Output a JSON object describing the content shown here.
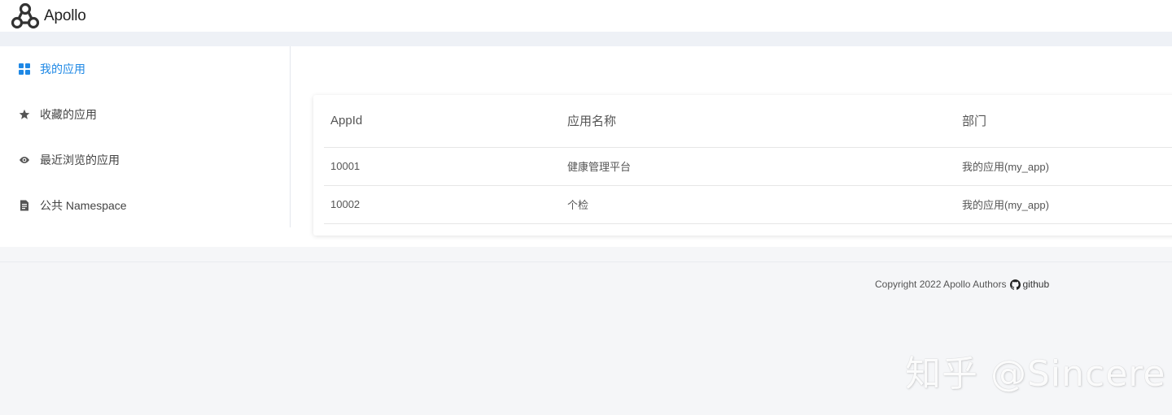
{
  "header": {
    "logo_text": "Apollo"
  },
  "sidebar": {
    "items": [
      {
        "label": "我的应用",
        "icon": "grid-icon",
        "active": true
      },
      {
        "label": "收藏的应用",
        "icon": "star-icon",
        "active": false
      },
      {
        "label": "最近浏览的应用",
        "icon": "eye-icon",
        "active": false
      },
      {
        "label": "公共 Namespace",
        "icon": "document-icon",
        "active": false
      }
    ]
  },
  "table": {
    "headers": [
      "AppId",
      "应用名称",
      "部门"
    ],
    "rows": [
      [
        "10001",
        "健康管理平台",
        "我的应用(my_app)"
      ],
      [
        "10002",
        "个检",
        "我的应用(my_app)"
      ]
    ]
  },
  "footer": {
    "copyright": "Copyright 2022 Apollo Authors",
    "github_label": "github"
  },
  "watermark": "知乎 @Sincere",
  "colors": {
    "accent": "#1e88e5",
    "band": "#eef1f6",
    "page_bg": "#f5f6f8"
  }
}
